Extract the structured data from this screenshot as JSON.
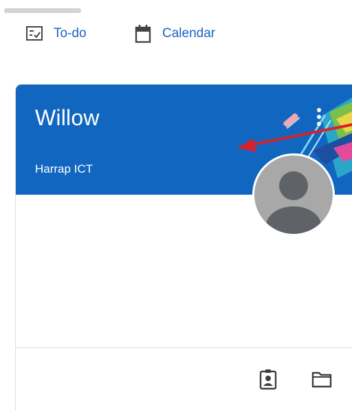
{
  "nav": {
    "todo_label": "To-do",
    "todo_icon": "todo-checklist-icon",
    "calendar_label": "Calendar",
    "calendar_icon": "calendar-icon"
  },
  "class_card": {
    "title": "Willow",
    "subtitle": "Harrap ICT",
    "header_color": "#1167bf",
    "more_icon": "more-vertical-icon",
    "avatar_icon": "default-avatar-icon",
    "footer_icons": [
      "assignment-ind-icon",
      "folder-icon"
    ]
  },
  "colors": {
    "link": "#1a63c7",
    "annotation_arrow": "#d3232c"
  }
}
